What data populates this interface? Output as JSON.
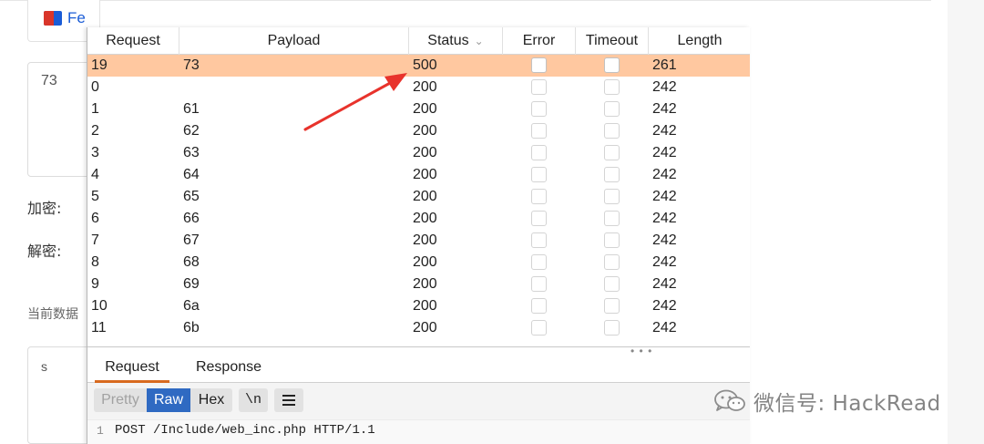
{
  "background_page": {
    "app_label": "Fe",
    "input_value": "73",
    "encrypt_label": "加密:",
    "decrypt_label": "解密:",
    "current_data_label": "当前数据",
    "output_value": "s"
  },
  "results_table": {
    "columns": [
      "Request",
      "Payload",
      "Status",
      "Error",
      "Timeout",
      "Length"
    ],
    "sort_indicator": "chevron-down",
    "rows": [
      {
        "request": "19",
        "payload": "73",
        "status": "500",
        "error": false,
        "timeout": false,
        "length": "261",
        "selected": true
      },
      {
        "request": "0",
        "payload": "",
        "status": "200",
        "error": false,
        "timeout": false,
        "length": "242",
        "selected": false
      },
      {
        "request": "1",
        "payload": "61",
        "status": "200",
        "error": false,
        "timeout": false,
        "length": "242",
        "selected": false
      },
      {
        "request": "2",
        "payload": "62",
        "status": "200",
        "error": false,
        "timeout": false,
        "length": "242",
        "selected": false
      },
      {
        "request": "3",
        "payload": "63",
        "status": "200",
        "error": false,
        "timeout": false,
        "length": "242",
        "selected": false
      },
      {
        "request": "4",
        "payload": "64",
        "status": "200",
        "error": false,
        "timeout": false,
        "length": "242",
        "selected": false
      },
      {
        "request": "5",
        "payload": "65",
        "status": "200",
        "error": false,
        "timeout": false,
        "length": "242",
        "selected": false
      },
      {
        "request": "6",
        "payload": "66",
        "status": "200",
        "error": false,
        "timeout": false,
        "length": "242",
        "selected": false
      },
      {
        "request": "7",
        "payload": "67",
        "status": "200",
        "error": false,
        "timeout": false,
        "length": "242",
        "selected": false
      },
      {
        "request": "8",
        "payload": "68",
        "status": "200",
        "error": false,
        "timeout": false,
        "length": "242",
        "selected": false
      },
      {
        "request": "9",
        "payload": "69",
        "status": "200",
        "error": false,
        "timeout": false,
        "length": "242",
        "selected": false
      },
      {
        "request": "10",
        "payload": "6a",
        "status": "200",
        "error": false,
        "timeout": false,
        "length": "242",
        "selected": false
      },
      {
        "request": "11",
        "payload": "6b",
        "status": "200",
        "error": false,
        "timeout": false,
        "length": "242",
        "selected": false
      }
    ]
  },
  "tabs": {
    "request": "Request",
    "response": "Response"
  },
  "toolbar": {
    "pretty": "Pretty",
    "raw": "Raw",
    "hex": "Hex",
    "newline": "\\n",
    "menu_icon": "hamburger-icon"
  },
  "code": {
    "line_number": "1",
    "line_text": "POST /Include/web_inc.php HTTP/1.1"
  },
  "watermark": {
    "icon": "wechat-icon",
    "text": "微信号: HackRead"
  },
  "colors": {
    "selected_row": "#ffc8a0",
    "raw_active": "#2f6ac2",
    "tab_underline": "#d86a1f",
    "arrow": "#e8332c"
  }
}
